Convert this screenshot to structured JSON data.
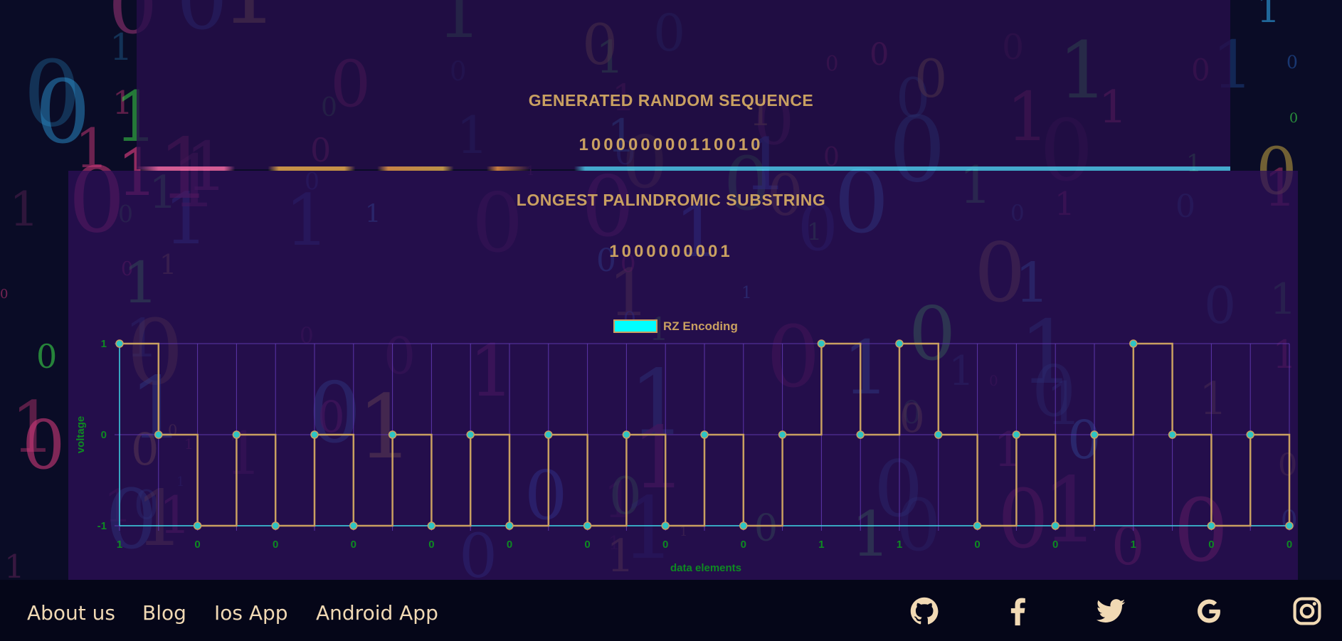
{
  "sections": {
    "generated_title": "GENERATED RANDOM SEQUENCE",
    "generated_sequence": "100000000110010",
    "palindrome_title": "LONGEST PALINDROMIC SUBSTRING",
    "palindrome_sequence": "1000000001"
  },
  "chart_data": {
    "type": "line",
    "legend": [
      {
        "name": "RZ Encoding",
        "color": "#00ffff",
        "position": "top"
      }
    ],
    "xlabel": "data elements",
    "ylabel": "voltage",
    "ylim": [
      -1,
      1
    ],
    "yticks": [
      "1",
      "0",
      "-1"
    ],
    "x_tick_labels": [
      "1",
      "0",
      "0",
      "0",
      "0",
      "0",
      "0",
      "0",
      "0",
      "1",
      "1",
      "0",
      "0",
      "1",
      "0",
      "0"
    ],
    "bits": [
      1,
      0,
      0,
      0,
      0,
      0,
      0,
      0,
      0,
      1,
      1,
      0,
      0,
      1,
      0
    ],
    "series": [
      {
        "name": "RZ Encoding",
        "line_color": "#c9a061",
        "point_color": "#2ec4c4",
        "stepped": true,
        "values": [
          1,
          0,
          -1,
          0,
          -1,
          0,
          -1,
          0,
          -1,
          0,
          -1,
          0,
          -1,
          0,
          -1,
          0,
          -1,
          0,
          1,
          0,
          1,
          0,
          -1,
          0,
          -1,
          0,
          1,
          0,
          -1,
          0,
          -1
        ]
      }
    ],
    "grid": true,
    "colors": {
      "grid": "#6a3fc2",
      "axis": "#3fd9e8",
      "tick_text": "#0e8a22"
    }
  },
  "footer": {
    "links": [
      "About us",
      "Blog",
      "Ios App",
      "Android App"
    ],
    "social_icons": [
      "github-icon",
      "facebook-icon",
      "twitter-icon",
      "google-icon",
      "instagram-icon"
    ]
  }
}
